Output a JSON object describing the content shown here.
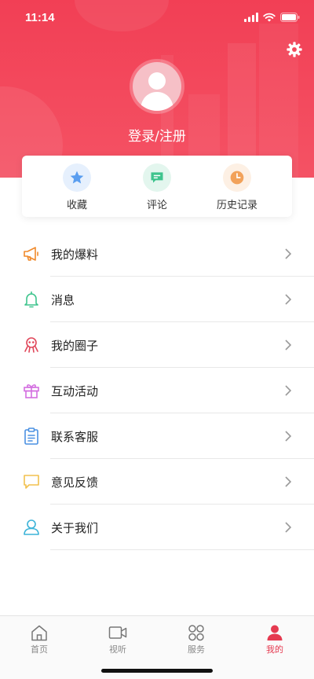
{
  "status_bar": {
    "time": "11:14"
  },
  "header": {
    "login_text": "登录/注册"
  },
  "quick_actions": [
    {
      "label": "收藏",
      "icon": "star-icon",
      "color": "#5a9ef0",
      "bg": "#e6f0fd"
    },
    {
      "label": "评论",
      "icon": "comment-icon",
      "color": "#3ec48d",
      "bg": "#e3f6ee"
    },
    {
      "label": "历史记录",
      "icon": "clock-icon",
      "color": "#f2a25a",
      "bg": "#fdf0e4"
    }
  ],
  "menu": [
    {
      "label": "我的爆料",
      "icon": "megaphone-icon",
      "color": "#f08a2c"
    },
    {
      "label": "消息",
      "icon": "bell-icon",
      "color": "#3ec48d"
    },
    {
      "label": "我的圈子",
      "icon": "circle-group-icon",
      "color": "#e0475a"
    },
    {
      "label": "互动活动",
      "icon": "gift-icon",
      "color": "#d36ee0"
    },
    {
      "label": "联系客服",
      "icon": "clipboard-icon",
      "color": "#4a90e2"
    },
    {
      "label": "意见反馈",
      "icon": "feedback-icon",
      "color": "#f2c14e"
    },
    {
      "label": "关于我们",
      "icon": "user-outline-icon",
      "color": "#3bb3d8"
    }
  ],
  "tabbar": [
    {
      "label": "首页",
      "icon": "home-icon",
      "active": false
    },
    {
      "label": "视听",
      "icon": "video-icon",
      "active": false
    },
    {
      "label": "服务",
      "icon": "grid-icon",
      "active": false
    },
    {
      "label": "我的",
      "icon": "person-icon",
      "active": true
    }
  ],
  "colors": {
    "brand": "#f23f55",
    "active_tab": "#e53a50"
  }
}
